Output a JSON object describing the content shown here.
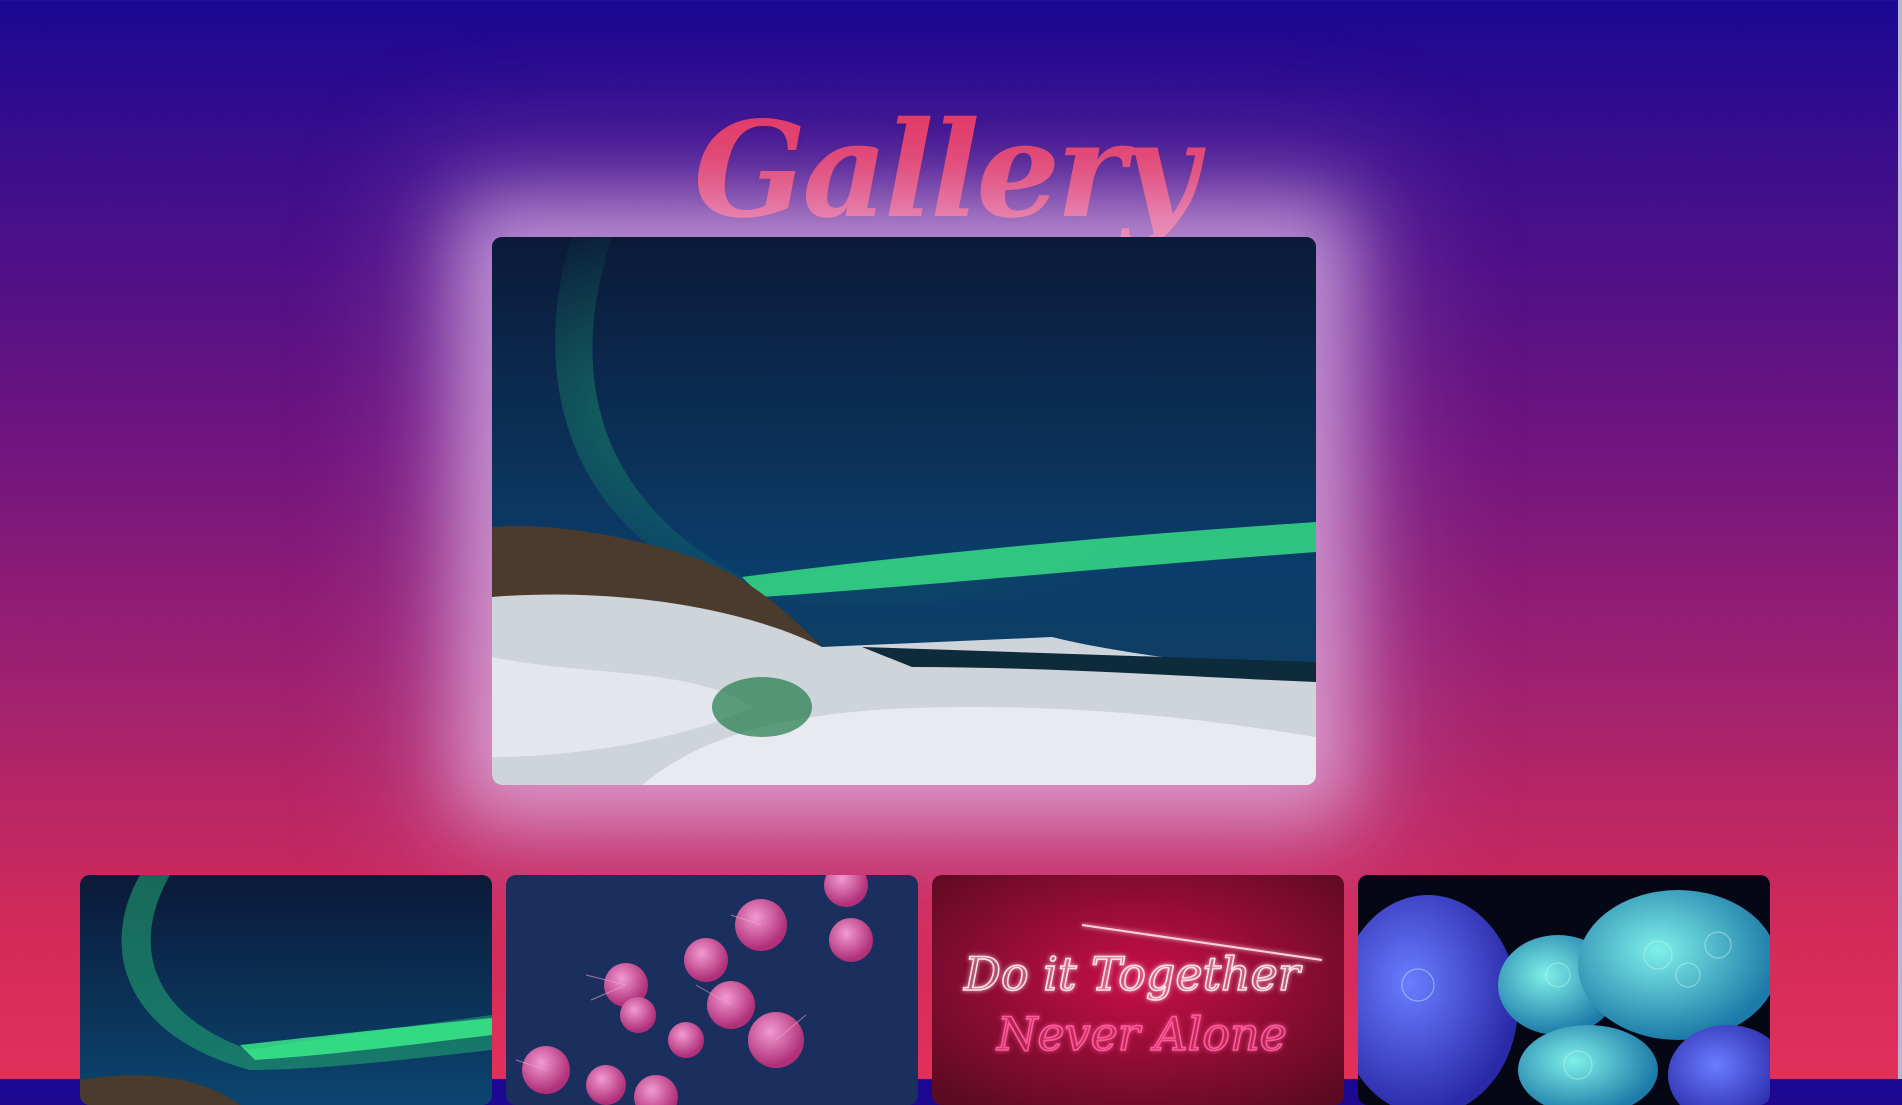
{
  "header": {
    "title": "Gallery"
  },
  "hero": {
    "icon": "aurora-image"
  },
  "thumbnails": [
    {
      "icon": "aurora-image"
    },
    {
      "icon": "jellyfish-image"
    },
    {
      "icon": "neon-sign-image",
      "lines": [
        "Do it Together",
        "Never Alone"
      ]
    },
    {
      "icon": "coral-image"
    }
  ],
  "colors": {
    "title": "#e23660",
    "bg_top": "#1a0892",
    "bg_bottom": "#e2305a",
    "neon": "#ff3a7a"
  }
}
